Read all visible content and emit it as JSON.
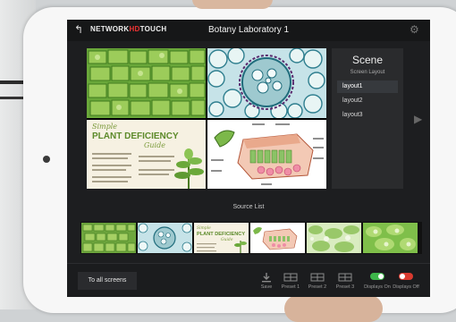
{
  "header": {
    "brand_prefix": "NETWORK",
    "brand_hd": "HD",
    "brand_suffix": "TOUCH",
    "title": "Botany Laboratory 1"
  },
  "scene": {
    "title": "Scene",
    "subtitle": "Screen Layout",
    "layouts": [
      "layout1",
      "layout2",
      "layout3"
    ],
    "active_layout": "layout1"
  },
  "preview": {
    "poster_line1": "Simple",
    "poster_line2": "PLANT DEFICIENCY",
    "poster_line3": "Guide"
  },
  "source_list": {
    "label": "Source List"
  },
  "toolbar": {
    "all_screens": "To all screens",
    "save": "Save",
    "preset1": "Preset 1",
    "preset2": "Preset 2",
    "preset3": "Preset 3",
    "displays_on": "Displays On",
    "displays_off": "Displays Off"
  },
  "colors": {
    "accent_green": "#3db54a",
    "accent_red": "#d93a2f",
    "brand_red": "#e33333"
  }
}
